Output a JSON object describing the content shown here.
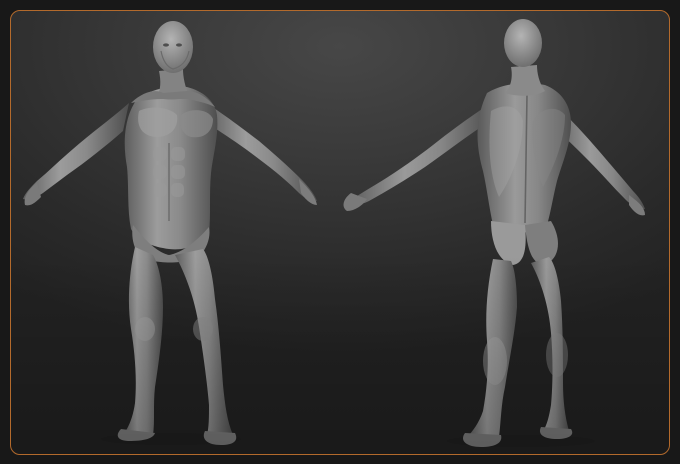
{
  "scene": {
    "views": [
      "front-three-quarter",
      "back-three-quarter"
    ],
    "subject": "anatomy-sculpt-figure",
    "border_color": "#b36a2c",
    "skin_color": "#8f8f8f"
  }
}
